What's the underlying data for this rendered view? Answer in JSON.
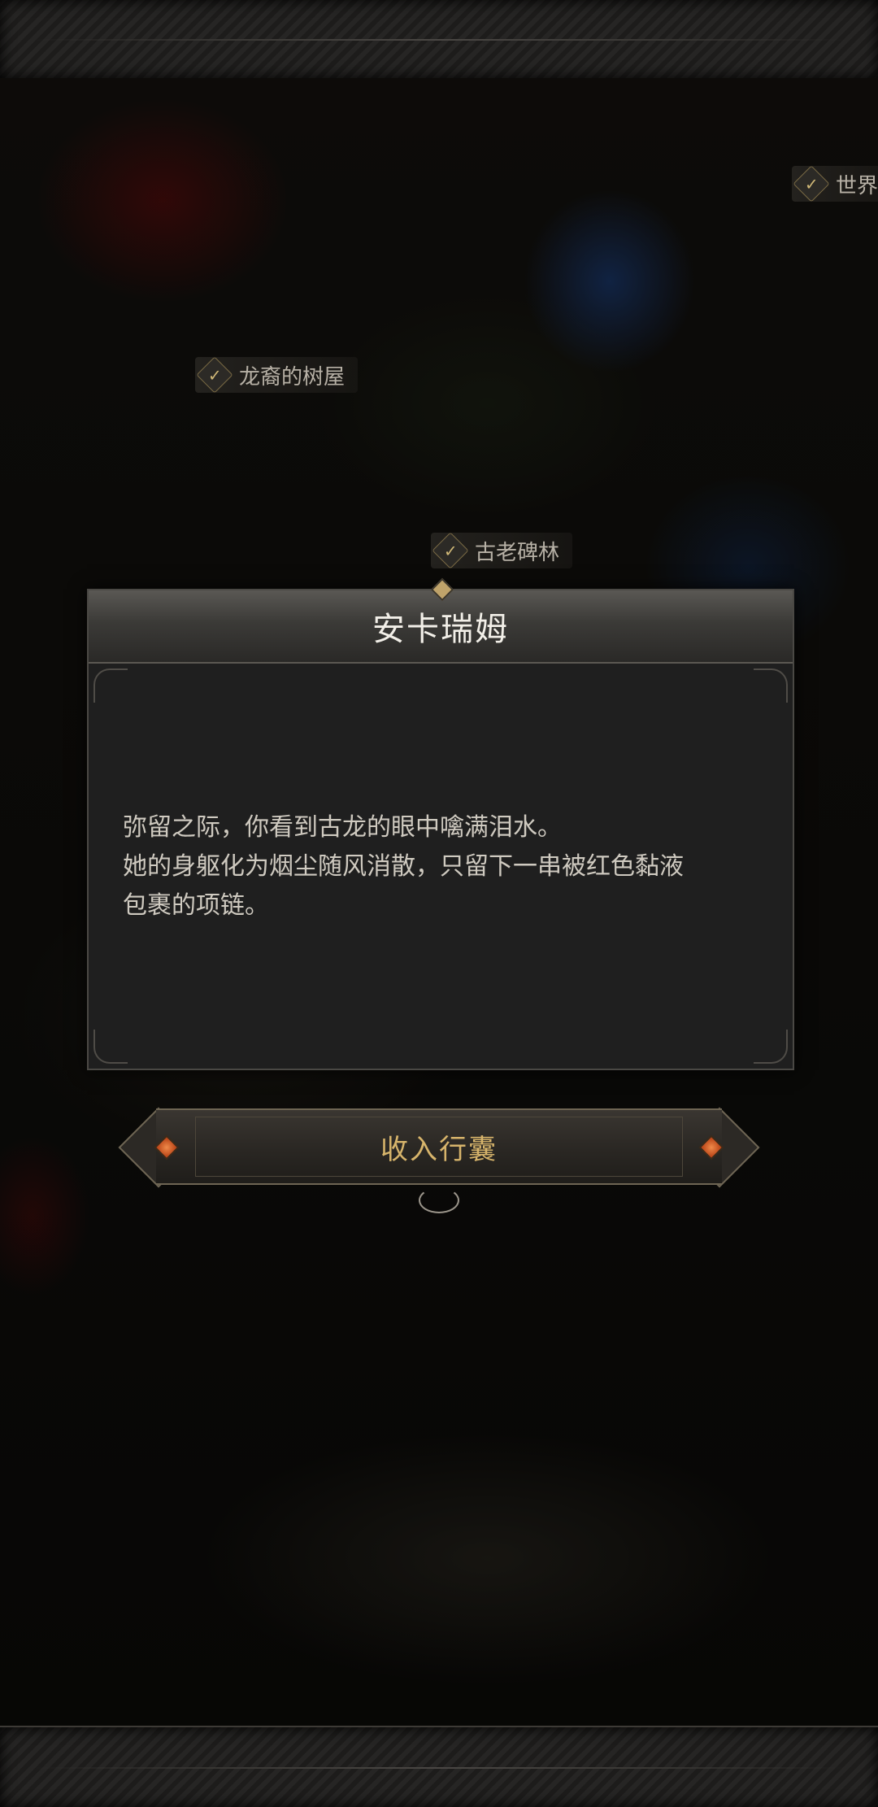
{
  "map": {
    "labels": [
      {
        "name": "世界",
        "completed": true
      },
      {
        "name": "龙裔的树屋",
        "completed": true
      },
      {
        "name": "古老碑林",
        "completed": true
      }
    ],
    "check_icon": "✓"
  },
  "dialog": {
    "title": "安卡瑞姆",
    "lines": [
      "弥留之际，你看到古龙的眼中噙满泪水。",
      "她的身躯化为烟尘随风消散，只留下一串被红色黏液",
      "包裹的项链。"
    ]
  },
  "actions": {
    "collect_label": "收入行囊"
  },
  "colors": {
    "gold": "#d7b46b",
    "title_text": "#f2efe8",
    "body_text": "#cfcac0",
    "panel_bg": "#1f1f1f"
  }
}
